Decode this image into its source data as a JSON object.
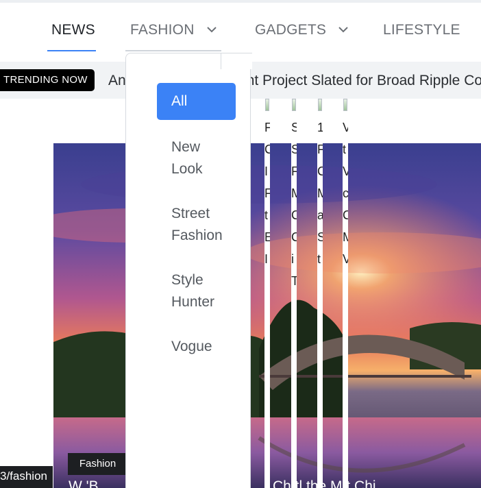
{
  "nav": {
    "items": [
      {
        "label": "NEWS",
        "active": true,
        "has_dropdown": false
      },
      {
        "label": "FASHION",
        "active": false,
        "has_dropdown": true
      },
      {
        "label": "GADGETS",
        "active": false,
        "has_dropdown": true
      },
      {
        "label": "LIFESTYLE",
        "active": false,
        "has_dropdown": false
      }
    ]
  },
  "trending": {
    "badge": "TRENDING NOW",
    "headline_start": "An",
    "headline_end": "nt Project Slated for Broad Ripple Co"
  },
  "dropdown": {
    "items": [
      {
        "label": "All",
        "active": true
      },
      {
        "label": "New\nLook",
        "active": false
      },
      {
        "label": "Street\nFashion",
        "active": false
      },
      {
        "label": "Style\nHunter",
        "active": false
      },
      {
        "label": "Vogue",
        "active": false
      }
    ]
  },
  "strips": [
    {
      "chars": "F\nC\nI\nF\nt\nE\nI"
    },
    {
      "chars": "S\nS\nF\nM\nC\nC\ni\nT"
    },
    {
      "chars": "1\nF\nC\nM\na\nS\nt"
    },
    {
      "chars": "V\nt\nV\nc\nC\nM\nV"
    }
  ],
  "hero": {
    "category_tag": "Fashion",
    "url_tag": "3/fashion",
    "peek_left": "W  'B",
    "peek_right": "Ch  tl  the M  t Chi"
  },
  "colors": {
    "accent": "#3b82f6",
    "badge_bg": "#000000"
  }
}
